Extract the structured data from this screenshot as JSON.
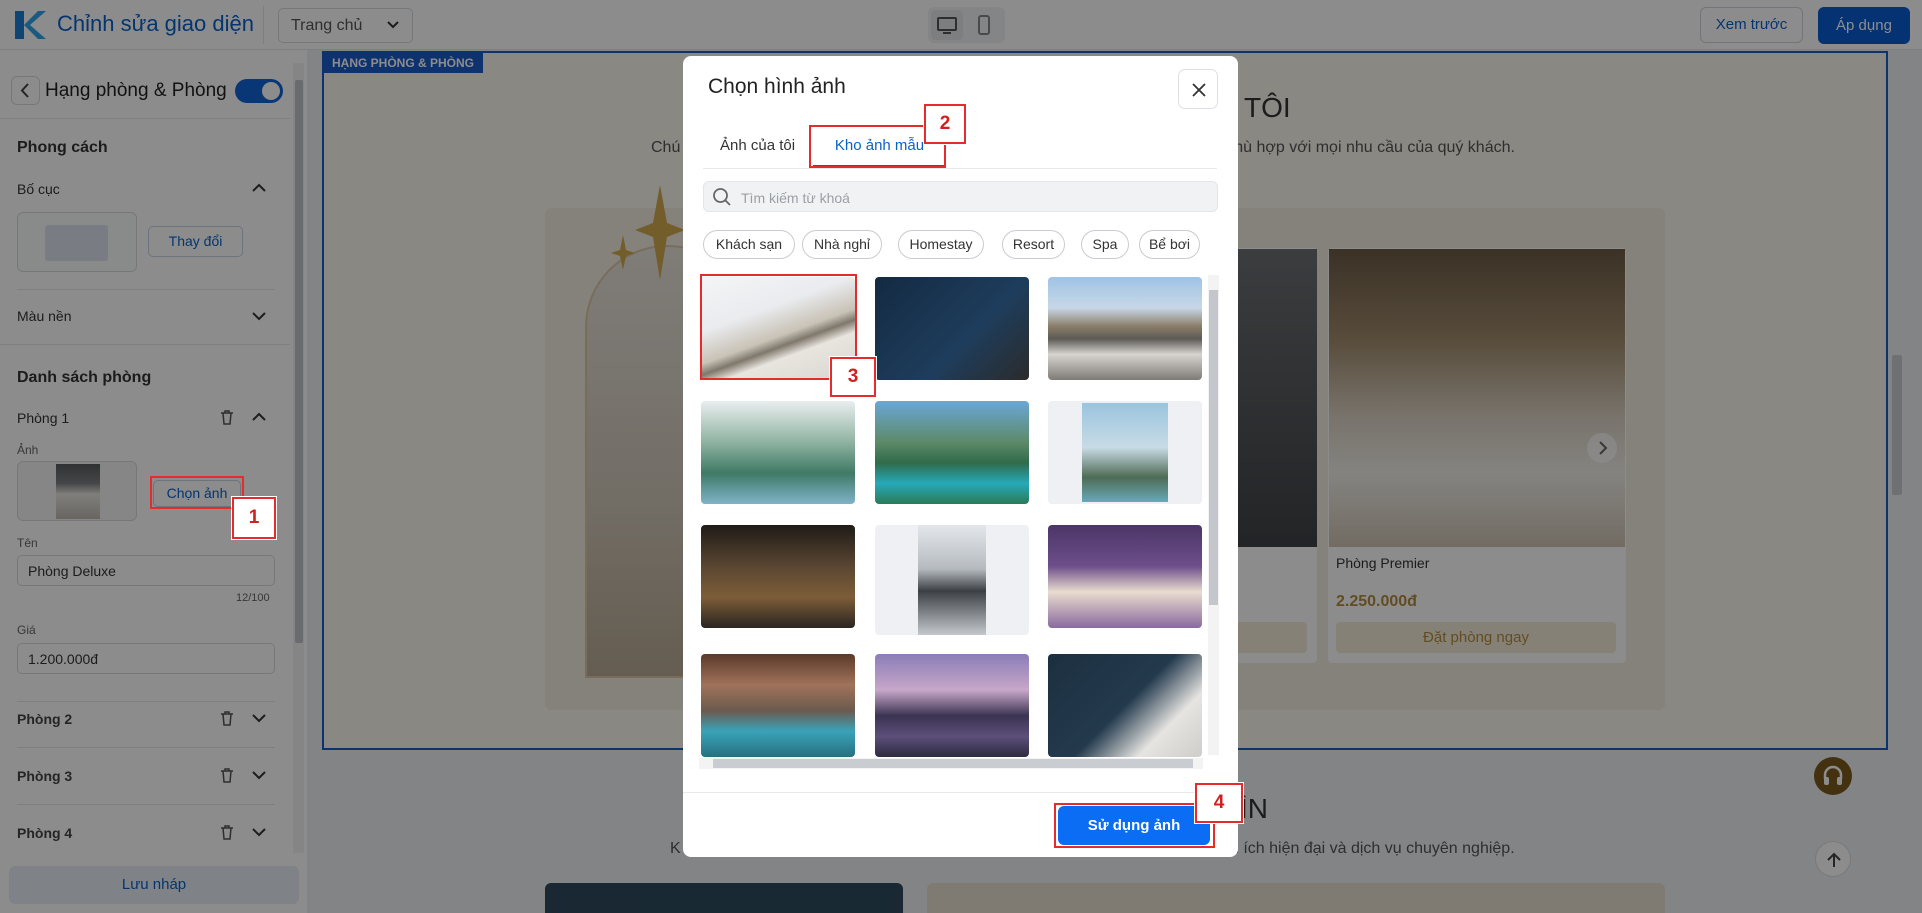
{
  "topbar": {
    "title": "Chỉnh sửa giao diện",
    "page_select": "Trang chủ",
    "preview": "Xem trước",
    "apply": "Áp dụng"
  },
  "sidebar": {
    "header": "Hạng phòng & Phòng",
    "style_section": "Phong cách",
    "layout_label": "Bố cục",
    "change_button": "Thay đổi",
    "bg_label": "Màu nền",
    "rooms_section": "Danh sách phòng",
    "room1": {
      "title": "Phòng 1",
      "image_label": "Ảnh",
      "choose_image": "Chọn ảnh",
      "name_label": "Tên",
      "name_value": "Phòng Deluxe",
      "name_counter": "12/100",
      "price_label": "Giá",
      "price_value": "1.200.000đ"
    },
    "rooms_collapsed": [
      "Phòng 2",
      "Phòng 3",
      "Phòng 4"
    ],
    "save_draft": "Lưu nháp"
  },
  "canvas": {
    "section_tag": "HẠNG PHÒNG & PHÒNG",
    "heading_partial": "G TÔI",
    "subtitle_left": "Chú",
    "subtitle_right": "g phù hợp với mọi nhu cầu của quý khách.",
    "room_card": {
      "name": "Phòng Premier",
      "price": "2.250.000đ",
      "book": "Đặt phòng ngay"
    },
    "heading2_partial": "ÌN",
    "sub2_left": "K",
    "sub2_right": "n ích hiện đại và dịch vụ chuyên nghiệp."
  },
  "modal": {
    "title": "Chọn hình ảnh",
    "tabs": [
      "Ảnh của tôi",
      "Kho ảnh mẫu"
    ],
    "active_tab": "Kho ảnh mẫu",
    "search_placeholder": "Tìm kiếm từ khoá",
    "chips": [
      "Khách sạn",
      "Nhà nghỉ",
      "Homestay",
      "Resort",
      "Spa",
      "Bể bơi"
    ],
    "use_button": "Sử dụng ảnh"
  },
  "annotations": [
    "1",
    "2",
    "3",
    "4"
  ],
  "colors": {
    "primary": "#0a5cd1",
    "accent_red": "#e52b2b",
    "gold": "#b38c40"
  }
}
